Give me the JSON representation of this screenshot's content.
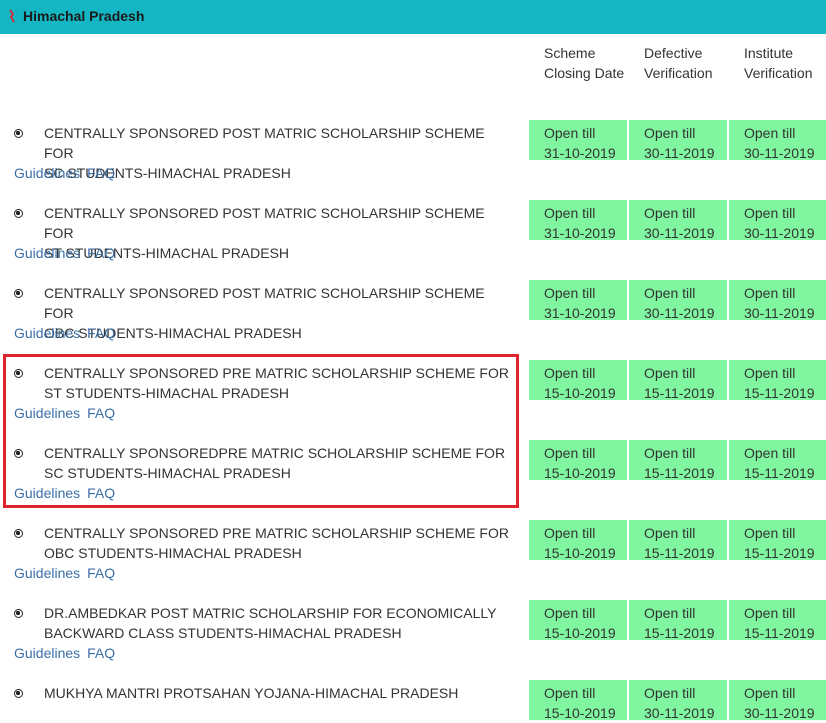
{
  "header": {
    "title": "Himachal Pradesh"
  },
  "columns": [
    "Scheme Closing Date",
    "Defective Verification",
    "Institute Verification"
  ],
  "links": {
    "guidelines": "Guidelines",
    "faq": "FAQ"
  },
  "open_prefix": "Open till",
  "schemes": [
    {
      "line1": "CENTRALLY SPONSORED POST MATRIC SCHOLARSHIP SCHEME FOR",
      "line2": "SC STUDENTS-HIMACHAL PRADESH",
      "dates": [
        "31-10-2019",
        "30-11-2019",
        "30-11-2019"
      ],
      "show_links": true
    },
    {
      "line1": "CENTRALLY SPONSORED POST MATRIC SCHOLARSHIP SCHEME FOR",
      "line2": "ST STUDENTS-HIMACHAL PRADESH",
      "dates": [
        "31-10-2019",
        "30-11-2019",
        "30-11-2019"
      ],
      "show_links": true
    },
    {
      "line1": "CENTRALLY SPONSORED POST MATRIC SCHOLARSHIP SCHEME FOR",
      "line2": "OBC STUDENTS-HIMACHAL PRADESH",
      "dates": [
        "31-10-2019",
        "30-11-2019",
        "30-11-2019"
      ],
      "show_links": true
    },
    {
      "line1": "CENTRALLY SPONSORED PRE MATRIC SCHOLARSHIP SCHEME FOR",
      "line2": "ST STUDENTS-HIMACHAL PRADESH",
      "dates": [
        "15-10-2019",
        "15-11-2019",
        "15-11-2019"
      ],
      "show_links": true
    },
    {
      "line1": "CENTRALLY SPONSOREDPRE MATRIC SCHOLARSHIP SCHEME FOR",
      "line2": "SC STUDENTS-HIMACHAL PRADESH",
      "dates": [
        "15-10-2019",
        "15-11-2019",
        "15-11-2019"
      ],
      "show_links": true
    },
    {
      "line1": "CENTRALLY SPONSORED PRE MATRIC SCHOLARSHIP SCHEME FOR",
      "line2": "OBC STUDENTS-HIMACHAL PRADESH",
      "dates": [
        "15-10-2019",
        "15-11-2019",
        "15-11-2019"
      ],
      "show_links": true
    },
    {
      "line1": "DR.AMBEDKAR POST MATRIC SCHOLARSHIP FOR ECONOMICALLY",
      "line2": "BACKWARD CLASS STUDENTS-HIMACHAL PRADESH",
      "dates": [
        "15-10-2019",
        "15-11-2019",
        "15-11-2019"
      ],
      "show_links": true
    },
    {
      "line1": "MUKHYA MANTRI PROTSAHAN YOJANA-HIMACHAL PRADESH",
      "line2": "",
      "dates": [
        "15-10-2019",
        "30-11-2019",
        "30-11-2019"
      ],
      "show_links": false
    }
  ],
  "colors": {
    "header_bg": "#15b6c4",
    "cell_bg": "#80f6a0",
    "link": "#3a6fa8",
    "highlight": "#e0242e"
  }
}
